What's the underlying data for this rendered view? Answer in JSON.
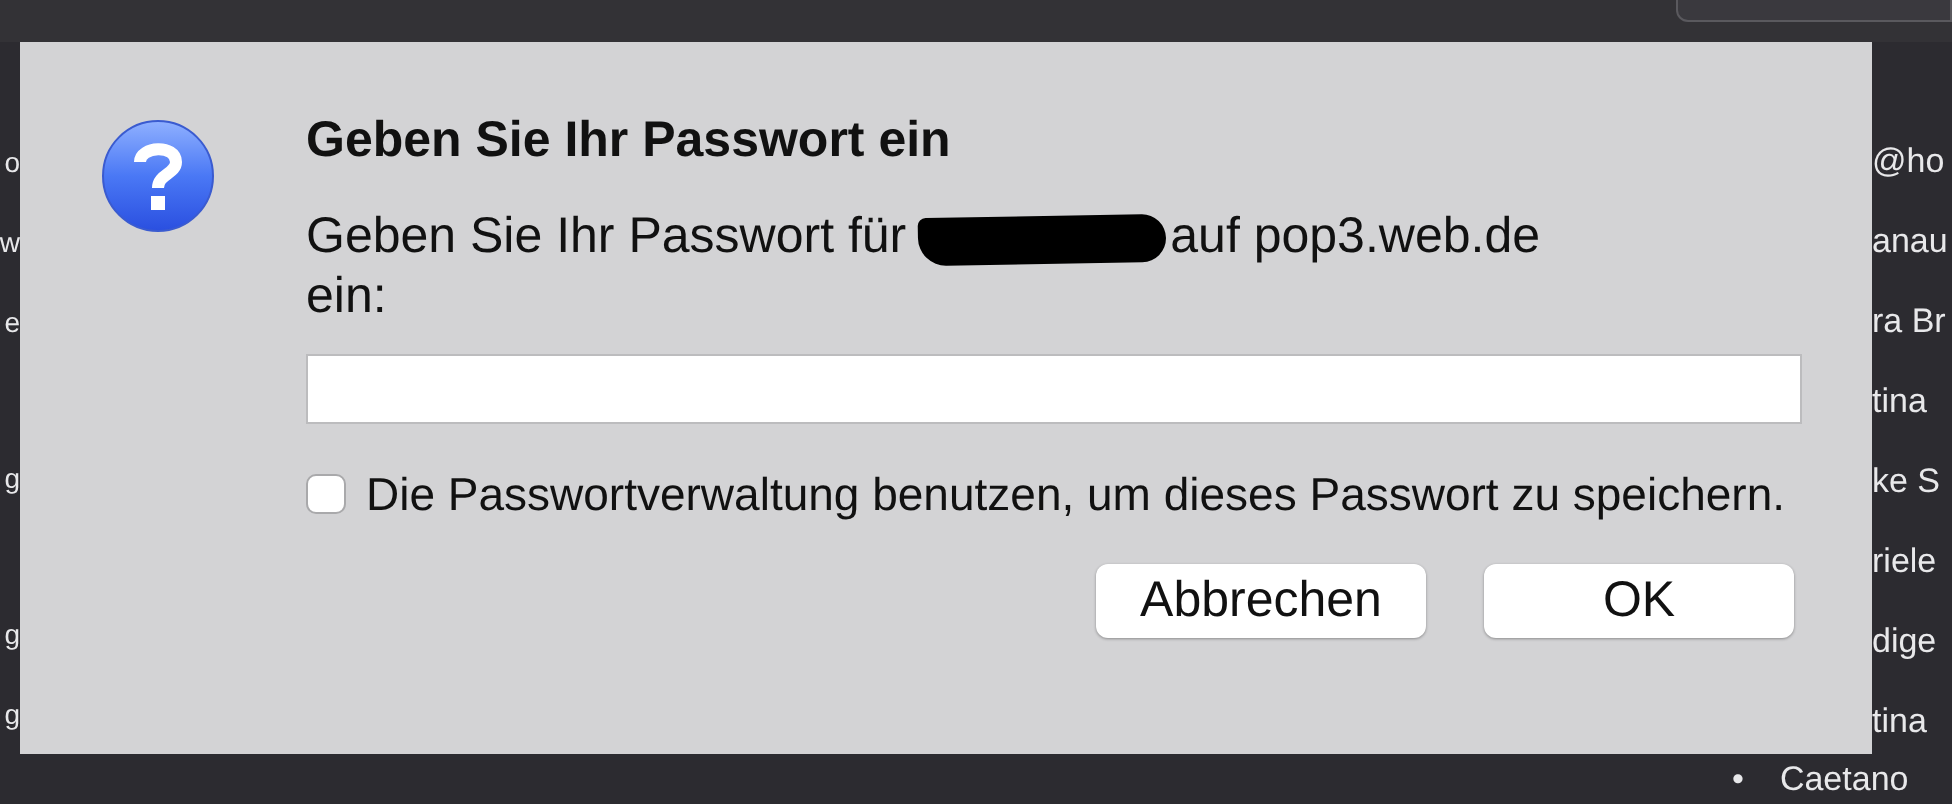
{
  "dialog": {
    "title": "Geben Sie Ihr Passwort ein",
    "message": {
      "before": "Geben Sie Ihr Passwort für",
      "redacted": true,
      "after": "auf pop3.web.de",
      "second_line": "ein:"
    },
    "remember_checkbox": {
      "label": "Die Passwortverwaltung benutzen, um dieses Passwort zu speichern.",
      "checked": false
    },
    "buttons": [
      {
        "label": "Abbrechen",
        "kind": "cancel"
      },
      {
        "label": "OK",
        "kind": "default"
      }
    ]
  },
  "background_left": [
    [
      "o",
      "w",
      "e"
    ],
    [
      "g"
    ],
    [
      "g",
      "g"
    ]
  ],
  "background_right": [
    {
      "text": "@ho"
    },
    {
      "text": "anau"
    },
    {
      "text": "ra Br"
    },
    {
      "text": "tina"
    },
    {
      "text": "ke S"
    },
    {
      "text": "riele"
    },
    {
      "text": "dige"
    },
    {
      "text": "tina"
    }
  ],
  "background_bottom": {
    "bullet": "•",
    "text": "Caetano"
  }
}
